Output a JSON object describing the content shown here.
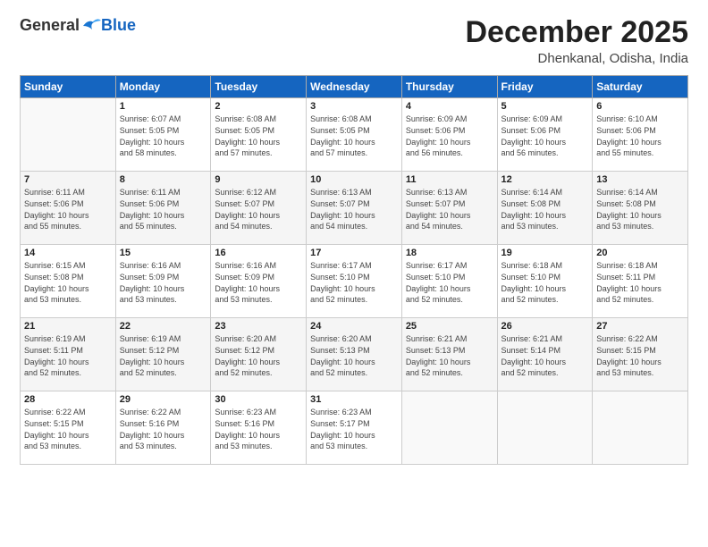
{
  "header": {
    "logo_general": "General",
    "logo_blue": "Blue",
    "month_title": "December 2025",
    "subtitle": "Dhenkanal, Odisha, India"
  },
  "days_of_week": [
    "Sunday",
    "Monday",
    "Tuesday",
    "Wednesday",
    "Thursday",
    "Friday",
    "Saturday"
  ],
  "weeks": [
    [
      {
        "day": "",
        "detail": ""
      },
      {
        "day": "1",
        "detail": "Sunrise: 6:07 AM\nSunset: 5:05 PM\nDaylight: 10 hours\nand 58 minutes."
      },
      {
        "day": "2",
        "detail": "Sunrise: 6:08 AM\nSunset: 5:05 PM\nDaylight: 10 hours\nand 57 minutes."
      },
      {
        "day": "3",
        "detail": "Sunrise: 6:08 AM\nSunset: 5:05 PM\nDaylight: 10 hours\nand 57 minutes."
      },
      {
        "day": "4",
        "detail": "Sunrise: 6:09 AM\nSunset: 5:06 PM\nDaylight: 10 hours\nand 56 minutes."
      },
      {
        "day": "5",
        "detail": "Sunrise: 6:09 AM\nSunset: 5:06 PM\nDaylight: 10 hours\nand 56 minutes."
      },
      {
        "day": "6",
        "detail": "Sunrise: 6:10 AM\nSunset: 5:06 PM\nDaylight: 10 hours\nand 55 minutes."
      }
    ],
    [
      {
        "day": "7",
        "detail": "Sunrise: 6:11 AM\nSunset: 5:06 PM\nDaylight: 10 hours\nand 55 minutes."
      },
      {
        "day": "8",
        "detail": "Sunrise: 6:11 AM\nSunset: 5:06 PM\nDaylight: 10 hours\nand 55 minutes."
      },
      {
        "day": "9",
        "detail": "Sunrise: 6:12 AM\nSunset: 5:07 PM\nDaylight: 10 hours\nand 54 minutes."
      },
      {
        "day": "10",
        "detail": "Sunrise: 6:13 AM\nSunset: 5:07 PM\nDaylight: 10 hours\nand 54 minutes."
      },
      {
        "day": "11",
        "detail": "Sunrise: 6:13 AM\nSunset: 5:07 PM\nDaylight: 10 hours\nand 54 minutes."
      },
      {
        "day": "12",
        "detail": "Sunrise: 6:14 AM\nSunset: 5:08 PM\nDaylight: 10 hours\nand 53 minutes."
      },
      {
        "day": "13",
        "detail": "Sunrise: 6:14 AM\nSunset: 5:08 PM\nDaylight: 10 hours\nand 53 minutes."
      }
    ],
    [
      {
        "day": "14",
        "detail": "Sunrise: 6:15 AM\nSunset: 5:08 PM\nDaylight: 10 hours\nand 53 minutes."
      },
      {
        "day": "15",
        "detail": "Sunrise: 6:16 AM\nSunset: 5:09 PM\nDaylight: 10 hours\nand 53 minutes."
      },
      {
        "day": "16",
        "detail": "Sunrise: 6:16 AM\nSunset: 5:09 PM\nDaylight: 10 hours\nand 53 minutes."
      },
      {
        "day": "17",
        "detail": "Sunrise: 6:17 AM\nSunset: 5:10 PM\nDaylight: 10 hours\nand 52 minutes."
      },
      {
        "day": "18",
        "detail": "Sunrise: 6:17 AM\nSunset: 5:10 PM\nDaylight: 10 hours\nand 52 minutes."
      },
      {
        "day": "19",
        "detail": "Sunrise: 6:18 AM\nSunset: 5:10 PM\nDaylight: 10 hours\nand 52 minutes."
      },
      {
        "day": "20",
        "detail": "Sunrise: 6:18 AM\nSunset: 5:11 PM\nDaylight: 10 hours\nand 52 minutes."
      }
    ],
    [
      {
        "day": "21",
        "detail": "Sunrise: 6:19 AM\nSunset: 5:11 PM\nDaylight: 10 hours\nand 52 minutes."
      },
      {
        "day": "22",
        "detail": "Sunrise: 6:19 AM\nSunset: 5:12 PM\nDaylight: 10 hours\nand 52 minutes."
      },
      {
        "day": "23",
        "detail": "Sunrise: 6:20 AM\nSunset: 5:12 PM\nDaylight: 10 hours\nand 52 minutes."
      },
      {
        "day": "24",
        "detail": "Sunrise: 6:20 AM\nSunset: 5:13 PM\nDaylight: 10 hours\nand 52 minutes."
      },
      {
        "day": "25",
        "detail": "Sunrise: 6:21 AM\nSunset: 5:13 PM\nDaylight: 10 hours\nand 52 minutes."
      },
      {
        "day": "26",
        "detail": "Sunrise: 6:21 AM\nSunset: 5:14 PM\nDaylight: 10 hours\nand 52 minutes."
      },
      {
        "day": "27",
        "detail": "Sunrise: 6:22 AM\nSunset: 5:15 PM\nDaylight: 10 hours\nand 53 minutes."
      }
    ],
    [
      {
        "day": "28",
        "detail": "Sunrise: 6:22 AM\nSunset: 5:15 PM\nDaylight: 10 hours\nand 53 minutes."
      },
      {
        "day": "29",
        "detail": "Sunrise: 6:22 AM\nSunset: 5:16 PM\nDaylight: 10 hours\nand 53 minutes."
      },
      {
        "day": "30",
        "detail": "Sunrise: 6:23 AM\nSunset: 5:16 PM\nDaylight: 10 hours\nand 53 minutes."
      },
      {
        "day": "31",
        "detail": "Sunrise: 6:23 AM\nSunset: 5:17 PM\nDaylight: 10 hours\nand 53 minutes."
      },
      {
        "day": "",
        "detail": ""
      },
      {
        "day": "",
        "detail": ""
      },
      {
        "day": "",
        "detail": ""
      }
    ]
  ]
}
